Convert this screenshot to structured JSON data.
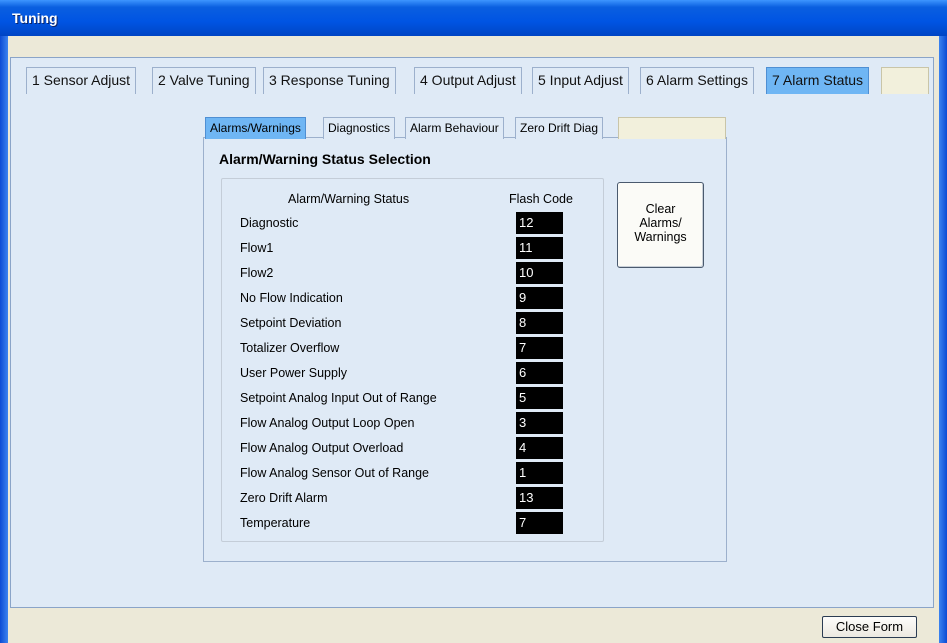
{
  "window": {
    "title": "Tuning"
  },
  "tabs": [
    {
      "label": "1 Sensor Adjust",
      "active": false
    },
    {
      "label": "2 Valve Tuning",
      "active": false
    },
    {
      "label": "3 Response Tuning",
      "active": false
    },
    {
      "label": "4 Output Adjust",
      "active": false
    },
    {
      "label": "5 Input Adjust",
      "active": false
    },
    {
      "label": "6 Alarm Settings",
      "active": false
    },
    {
      "label": "7 Alarm Status",
      "active": true
    }
  ],
  "subtabs": [
    {
      "label": "Alarms/Warnings",
      "active": true
    },
    {
      "label": "Diagnostics",
      "active": false
    },
    {
      "label": "Alarm Behaviour",
      "active": false
    },
    {
      "label": "Zero Drift Diag",
      "active": false
    }
  ],
  "section_title": "Alarm/Warning Status Selection",
  "table": {
    "headers": {
      "status": "Alarm/Warning Status",
      "flash": "Flash Code"
    },
    "rows": [
      {
        "label": "Diagnostic",
        "code": "12"
      },
      {
        "label": "Flow1",
        "code": "11"
      },
      {
        "label": "Flow2",
        "code": "10"
      },
      {
        "label": "No Flow Indication",
        "code": "9"
      },
      {
        "label": "Setpoint Deviation",
        "code": "8"
      },
      {
        "label": "Totalizer Overflow",
        "code": "7"
      },
      {
        "label": "User Power Supply",
        "code": "6"
      },
      {
        "label": "Setpoint Analog Input Out of Range",
        "code": "5"
      },
      {
        "label": "Flow Analog Output Loop Open",
        "code": "3"
      },
      {
        "label": "Flow Analog Output Overload",
        "code": "4"
      },
      {
        "label": "Flow Analog Sensor Out of Range",
        "code": "1"
      },
      {
        "label": "Zero Drift Alarm",
        "code": "13"
      },
      {
        "label": "Temperature",
        "code": "7"
      }
    ]
  },
  "buttons": {
    "clear_line1": "Clear",
    "clear_line2": "Alarms/",
    "clear_line3": "Warnings",
    "close": "Close Form"
  }
}
